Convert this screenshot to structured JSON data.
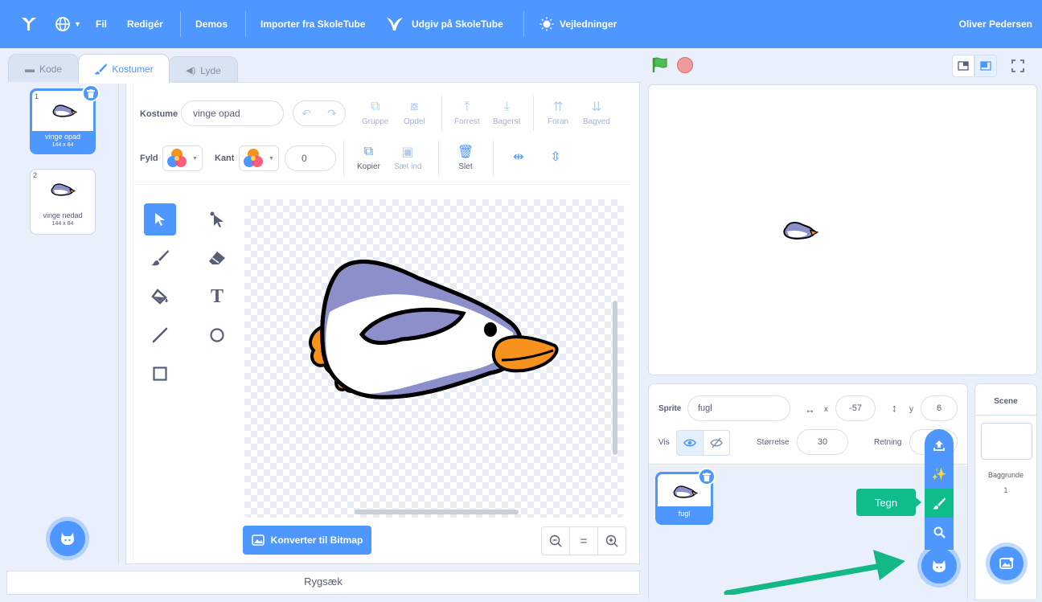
{
  "menu": {
    "file": "Fil",
    "edit": "Redigér",
    "demos": "Demos",
    "import": "Importer fra SkoleTube",
    "publish": "Udgiv på SkoleTube",
    "guides": "Vejledninger",
    "user": "Oliver Pedersen"
  },
  "tabs": {
    "code": "Kode",
    "costumes": "Kostumer",
    "sounds": "Lyde"
  },
  "costumes": [
    {
      "num": "1",
      "name": "vinge opad",
      "size": "144 x 84"
    },
    {
      "num": "2",
      "name": "vinge nedad",
      "size": "144 x 84"
    }
  ],
  "editor": {
    "costume_label": "Kostume",
    "costume_name": "vinge opad",
    "fill_label": "Fyld",
    "outline_label": "Kant",
    "outline_width": "0",
    "group": "Gruppe",
    "ungroup": "Opdel",
    "forward": "Forrest",
    "backward": "Bagerst",
    "front": "Foran",
    "back": "Bagved",
    "copy": "Kopier",
    "paste": "Sæt ind",
    "delete": "Slet",
    "convert": "Konverter til Bitmap",
    "zoom_reset": "="
  },
  "backpack": "Rygsæk",
  "sprite": {
    "label": "Sprite",
    "name": "fugl",
    "x_label": "x",
    "x": "-57",
    "y_label": "y",
    "y": "6",
    "show_label": "Vis",
    "size_label": "Størrelse",
    "size": "30",
    "direction_label": "Retning",
    "thumb_name": "fugl"
  },
  "scene": {
    "title": "Scene",
    "backdrops_label": "Baggrunde",
    "backdrops_count": "1"
  },
  "tooltip": "Tegn",
  "colors": {
    "accent": "#4d97ff",
    "green": "#0fbd8c",
    "penguin_body": "#8c8fc9",
    "beak": "#f7921e"
  }
}
